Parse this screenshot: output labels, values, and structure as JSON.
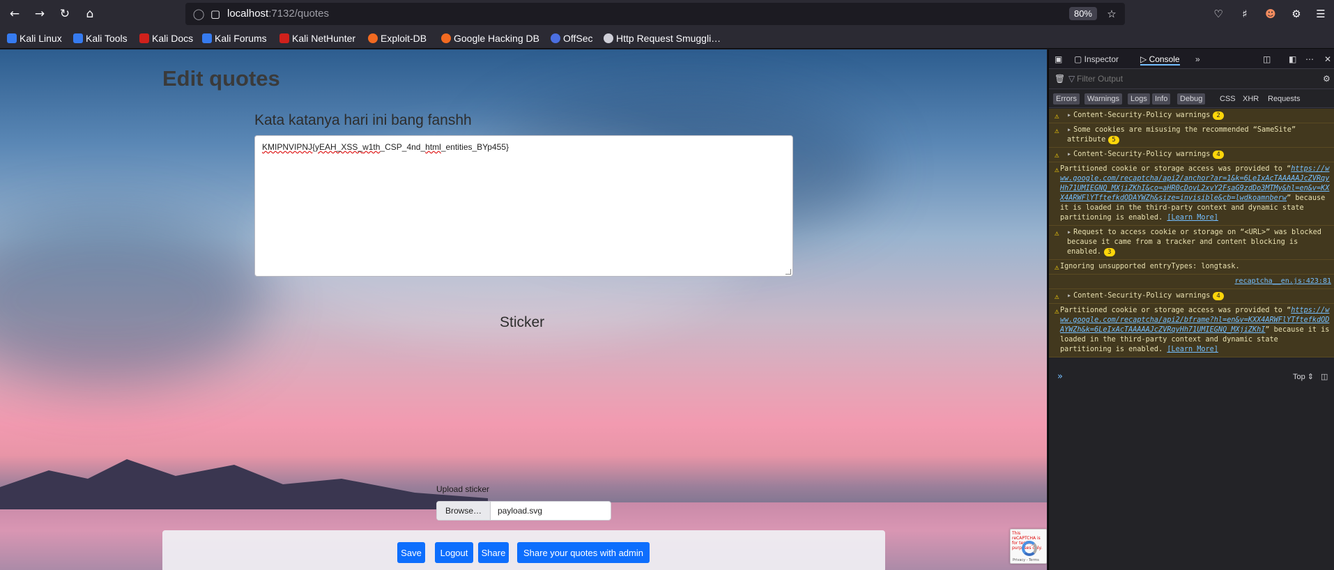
{
  "browser": {
    "url_host": "localhost",
    "url_path": ":7132/quotes",
    "zoom": "80%",
    "icons": [
      "back-icon",
      "forward-icon",
      "reload-icon",
      "home-icon",
      "shield-icon",
      "page-icon",
      "star-icon",
      "pocket-icon",
      "extensions-icon",
      "profile-icon",
      "addon-icon",
      "menu-icon"
    ]
  },
  "bookmarks": [
    {
      "label": "Kali Linux",
      "color": "#367bf0"
    },
    {
      "label": "Kali Tools",
      "color": "#367bf0"
    },
    {
      "label": "Kali Docs",
      "color": "#d0211c"
    },
    {
      "label": "Kali Forums",
      "color": "#367bf0"
    },
    {
      "label": "Kali NetHunter",
      "color": "#d0211c"
    },
    {
      "label": "Exploit-DB",
      "color": "#f26a21"
    },
    {
      "label": "Google Hacking DB",
      "color": "#f26a21"
    },
    {
      "label": "OffSec",
      "color": "#4b6fe1"
    },
    {
      "label": "Http Request Smuggli…",
      "color": "#cfcfd8"
    }
  ],
  "page": {
    "title": "Edit quotes",
    "quote_label": "Kata katanya hari ini bang fanshh",
    "quote_parts": [
      "KMIPNVIPNJ",
      "{yEAH_XSS_",
      "w1th",
      "_CSP_4nd_",
      "html",
      "_entities_BYp455}"
    ],
    "sticker_title": "Sticker",
    "upload_label": "Upload sticker",
    "browse_label": "Browse…",
    "file_name": "payload.svg",
    "buttons": {
      "save": "Save",
      "logout": "Logout",
      "share": "Share",
      "share_admin": "Share your quotes with admin"
    },
    "accent": "#0d6efd",
    "recaptcha": {
      "error_text": "This reCAPTCHA is for testing purposes only.",
      "privacy": "Privacy - Terms"
    }
  },
  "devtools": {
    "tabs": {
      "inspector": "Inspector",
      "console": "Console"
    },
    "filter_placeholder": "Filter Output",
    "levels": [
      "Errors",
      "Warnings",
      "Logs",
      "Info",
      "Debug"
    ],
    "extra_filters": [
      "CSS",
      "XHR",
      "Requests"
    ],
    "messages": [
      {
        "text": "Content-Security-Policy warnings",
        "count": "2",
        "expandable": true
      },
      {
        "text": "Some cookies are misusing the recommended “SameSite” attribute",
        "count": "5",
        "expandable": true
      },
      {
        "text": "Content-Security-Policy warnings",
        "count": "4",
        "expandable": true
      },
      {
        "pre": "Partitioned cookie or storage access was provided to “",
        "link": "https://www.google.com/recaptcha/api2/anchor?ar=1&k=6LeIxAcTAAAAAJcZVRqyHh71UMIEGNQ_MXjiZKhI&co=aHR0cDovL2xvY2FsaG9zdDo3MTMy&hl=en&v=KXX4ARWFlYTftefkdODAYWZh&size=invisible&cb=lwdkoamnberw",
        "post": "” because it is loaded in the third-party context and dynamic state partitioning is enabled.",
        "more": "[Learn More]"
      },
      {
        "text": "Request to access cookie or storage on “<URL>” was blocked because it came from a tracker and content blocking is enabled.",
        "count": "3",
        "expandable": true
      },
      {
        "text": "Ignoring unsupported entryTypes: longtask."
      },
      {
        "source": "recaptcha__en.js:423:81"
      },
      {
        "text": "Content-Security-Policy warnings",
        "count": "4",
        "expandable": true
      },
      {
        "pre": "Partitioned cookie or storage access was provided to “",
        "link": "https://www.google.com/recaptcha/api2/bframe?hl=en&v=KXX4ARWFlYTftefkdODAYWZh&k=6LeIxAcTAAAAAJcZVRqyHh71UMIEGNQ_MXjiZKhI",
        "post": "” because it is loaded in the third-party context and dynamic state partitioning is enabled.",
        "more": "[Learn More]"
      }
    ],
    "context": "Top"
  }
}
